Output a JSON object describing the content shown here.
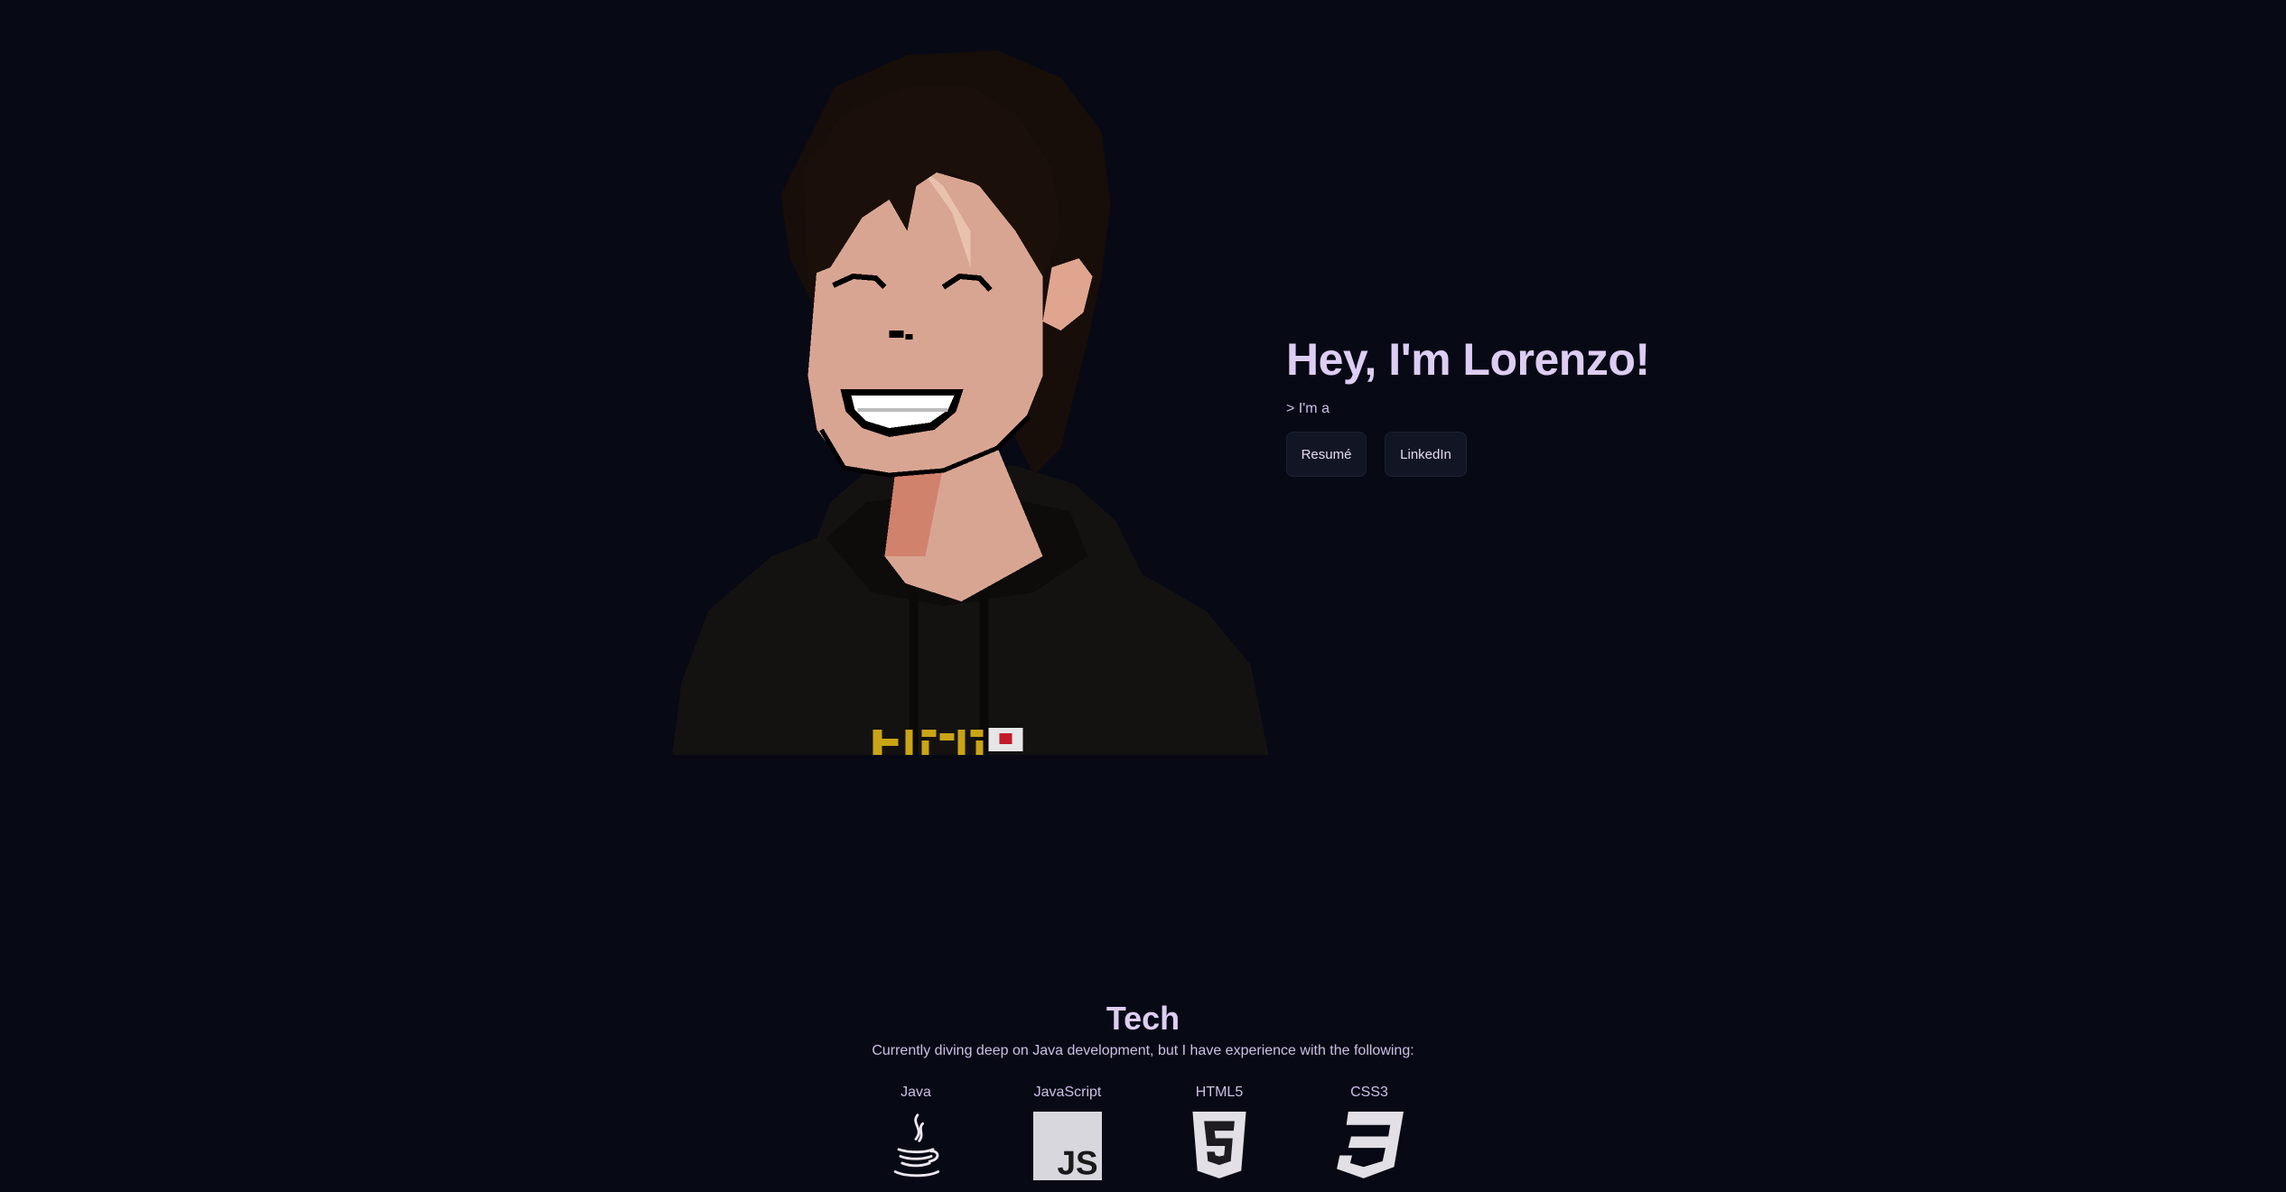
{
  "hero": {
    "title": "Hey, I'm Lorenzo!",
    "subtitle": "> I'm a",
    "buttons": [
      {
        "label": "Resumé"
      },
      {
        "label": "LinkedIn"
      }
    ]
  },
  "avatar": {
    "icon": "pixel-art-portrait",
    "shirt_text_icon": "katakana-text-with-japan-flag"
  },
  "tech": {
    "title": "Tech",
    "description": "Currently diving deep on Java development, but I have experience with the following:",
    "items": [
      {
        "label": "Java",
        "icon": "java-icon"
      },
      {
        "label": "JavaScript",
        "icon": "javascript-icon"
      },
      {
        "label": "HTML5",
        "icon": "html5-icon"
      },
      {
        "label": "CSS3",
        "icon": "css3-icon"
      }
    ]
  },
  "colors": {
    "background": "#070914",
    "text": "#ddcdf3",
    "button_bg": "#121624"
  }
}
